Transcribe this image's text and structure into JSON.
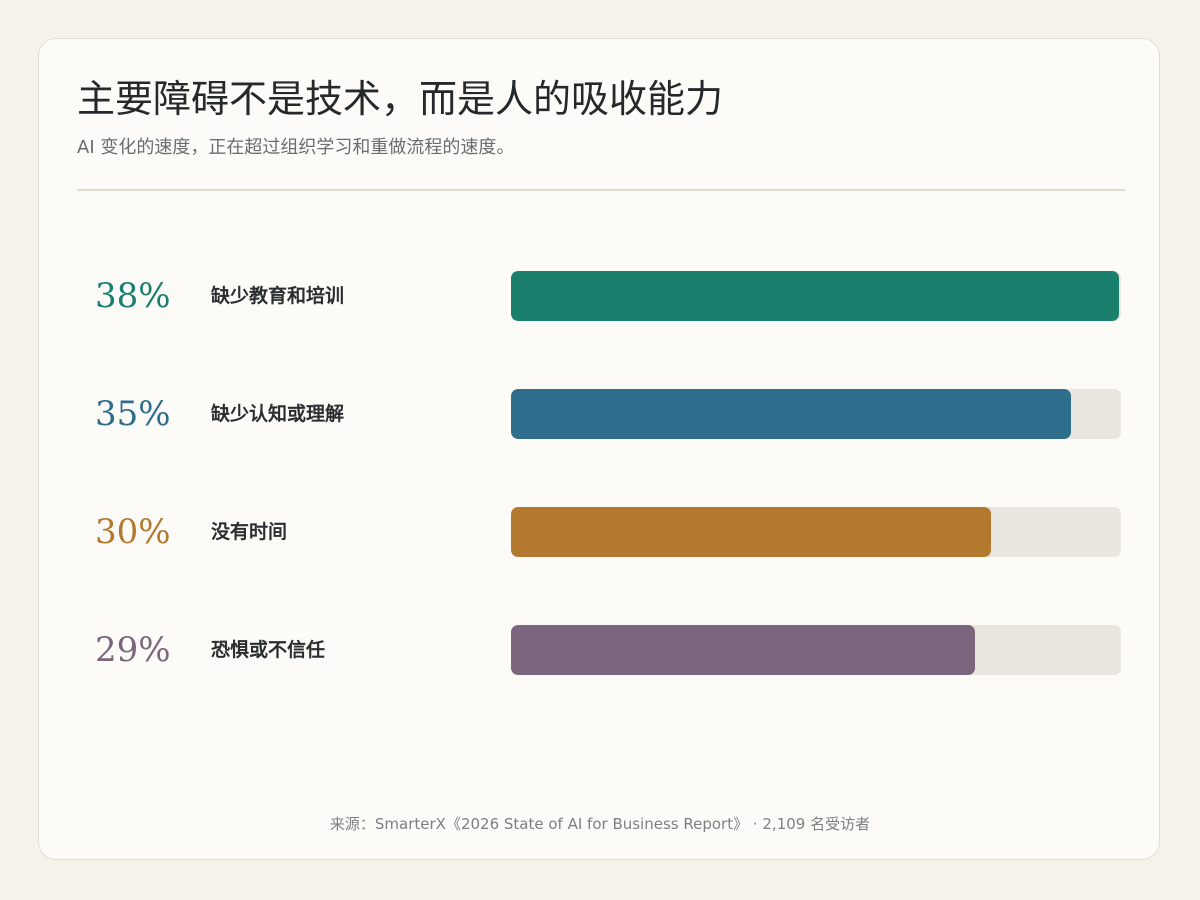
{
  "header": {
    "title": "主要障碍不是技术，而是人的吸收能力",
    "subtitle": "AI 变化的速度，正在超过组织学习和重做流程的速度。"
  },
  "chart_data": {
    "type": "bar",
    "orientation": "horizontal",
    "title": "主要障碍不是技术，而是人的吸收能力",
    "subtitle": "AI 变化的速度，正在超过组织学习和重做流程的速度。",
    "categories": [
      "缺少教育和培训",
      "缺少认知或理解",
      "没有时间",
      "恐惧或不信任"
    ],
    "values": [
      38,
      35,
      30,
      29
    ],
    "value_labels": [
      "38%",
      "35%",
      "30%",
      "29%"
    ],
    "colors": [
      "#1a7f6c",
      "#2f6d8c",
      "#b3792e",
      "#7b667d"
    ],
    "track_color": "#e9e6df",
    "xlim": [
      0,
      38
    ],
    "unit": "%",
    "grid": false,
    "legend": "none"
  },
  "footer": {
    "source": "来源：SmarterX《2026 State of AI for Business Report》 · 2,109 名受访者"
  }
}
